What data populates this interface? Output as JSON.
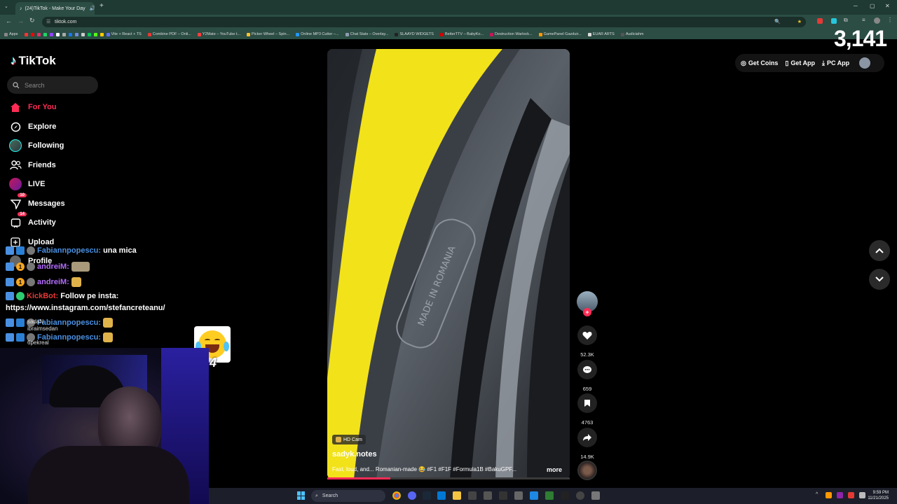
{
  "browser": {
    "tab_title": "(24)TikTok - Make Your Day",
    "url": "tiktok.com",
    "bookmarks": [
      {
        "label": "Apps",
        "color": "#888888"
      },
      {
        "label": "",
        "color": "#ff3333"
      },
      {
        "label": "",
        "color": "#ff0000"
      },
      {
        "label": "",
        "color": "#e1306c"
      },
      {
        "label": "",
        "color": "#25d366"
      },
      {
        "label": "",
        "color": "#9146ff"
      },
      {
        "label": "",
        "color": "#ffffff"
      },
      {
        "label": "",
        "color": "#aaaaaa"
      },
      {
        "label": "",
        "color": "#1877f2"
      },
      {
        "label": "",
        "color": "#7289da"
      },
      {
        "label": "",
        "color": "#cccccc"
      },
      {
        "label": "",
        "color": "#00c853"
      },
      {
        "label": "",
        "color": "#53fc18"
      },
      {
        "label": "",
        "color": "#ffcc00"
      },
      {
        "label": "Vite + React + TS",
        "color": "#646cff"
      },
      {
        "label": "Combine PDF – Onli...",
        "color": "#e53935"
      },
      {
        "label": "Y2Mate – YouTube t...",
        "color": "#ff3d3d"
      },
      {
        "label": "Picker Wheel – Spin...",
        "color": "#fbc02d"
      },
      {
        "label": "Online MP3 Cutter –...",
        "color": "#2196f3"
      },
      {
        "label": "Chat Stats – Overlay...",
        "color": "#8e9aaf"
      },
      {
        "label": "SLAAYD WIDGETS",
        "color": "#222222"
      },
      {
        "label": "BetterTTV – BabyKo...",
        "color": "#d50000"
      },
      {
        "label": "Destruction Warlock...",
        "color": "#c2185b"
      },
      {
        "label": "GamePanel Gazduir...",
        "color": "#ff9800"
      },
      {
        "label": "EUAR ARTS",
        "color": "#dddddd"
      },
      {
        "label": "Audiciahm",
        "color": "#555555"
      }
    ]
  },
  "counter": "3,141",
  "sidebar": {
    "logo": "TikTok",
    "search_placeholder": "Search",
    "items": [
      {
        "label": "For You",
        "active": true
      },
      {
        "label": "Explore"
      },
      {
        "label": "Following"
      },
      {
        "label": "Friends"
      },
      {
        "label": "LIVE"
      },
      {
        "label": "Messages",
        "badge": "10"
      },
      {
        "label": "Activity",
        "badge": "14"
      },
      {
        "label": "Upload"
      },
      {
        "label": "Profile"
      }
    ]
  },
  "chat": [
    {
      "user": "Fabiannpopescu:",
      "message": "una mica",
      "user_color": "#4a90e2"
    },
    {
      "user": "andreiM:",
      "message": "",
      "user_color": "#b36bff"
    },
    {
      "user": "andreiM:",
      "message": "",
      "user_color": "#b36bff"
    },
    {
      "user": "KickBot:",
      "message": "Follow pe insta:",
      "user_color": "#e53935"
    },
    {
      "user": "",
      "message": "https://www.instagram.com/stefancreteanu/",
      "user_color": "#ffffff"
    },
    {
      "user": "Fabiannpopescu:",
      "message": "",
      "user_color": "#4a90e2"
    },
    {
      "user": "Fabiannpopescu:",
      "message": "",
      "user_color": "#4a90e2"
    }
  ],
  "chat_overlay_names": [
    "sadaN",
    "ibraimsedan",
    "6pekreal"
  ],
  "emote_count": "x4",
  "topbar": {
    "get_coins": "Get Coins",
    "get_app": "Get App",
    "pc_app": "PC App"
  },
  "video": {
    "badge": "HD Cam",
    "author": "sadyk.notes",
    "caption": "Fast, loud, and... Romanian-made 😂 #F1 #F1F #Formula1B #BakuGPF...",
    "more": "more",
    "tyre_text": "MADE IN ROMANIA"
  },
  "actions": {
    "likes": "52.3K",
    "comments": "659",
    "saves": "4763",
    "shares": "14.9K"
  },
  "taskbar": {
    "search_placeholder": "Search",
    "time": "9:59 PM",
    "date": "11/21/2025"
  }
}
